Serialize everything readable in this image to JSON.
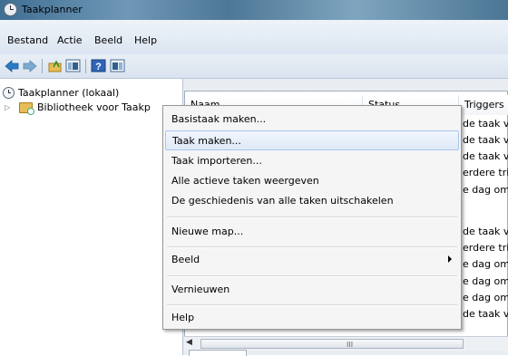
{
  "window": {
    "title": "Taakplanner"
  },
  "menubar": [
    "Bestand",
    "Actie",
    "Beeld",
    "Help"
  ],
  "toolbar": {
    "icons": [
      "back-arrow-icon",
      "forward-arrow-icon",
      "folder-up-icon",
      "console-tree-icon",
      "help-icon",
      "action-pane-icon"
    ],
    "colors": {
      "back": "#2b7bc7",
      "forward": "#2b7bc7"
    }
  },
  "tree": {
    "root": "Taakplanner (lokaal)",
    "child": "Bibliotheek voor Taakp"
  },
  "list": {
    "columns": [
      "Naam",
      "Status",
      "Triggers"
    ],
    "triggers": [
      "de taak v",
      "de taak v",
      "de taak v",
      "erdere tri",
      "e dag om",
      "",
      "de taak v",
      "erdere tri",
      "e dag om",
      "e dag om",
      "e dag om",
      "de taak v"
    ]
  },
  "context_menu": {
    "items": [
      {
        "label": "Basistaak maken..."
      },
      {
        "label": "Taak maken...",
        "highlighted": true
      },
      {
        "label": "Taak importeren..."
      },
      {
        "label": "Alle actieve taken weergeven"
      },
      {
        "label": "De geschiedenis van alle taken uitschakelen"
      },
      {
        "label": "Nieuwe map..."
      },
      {
        "label": "Beeld",
        "submenu": true
      },
      {
        "label": "Vernieuwen"
      },
      {
        "label": "Help"
      }
    ]
  },
  "scrollbar": {
    "grip": "III"
  }
}
